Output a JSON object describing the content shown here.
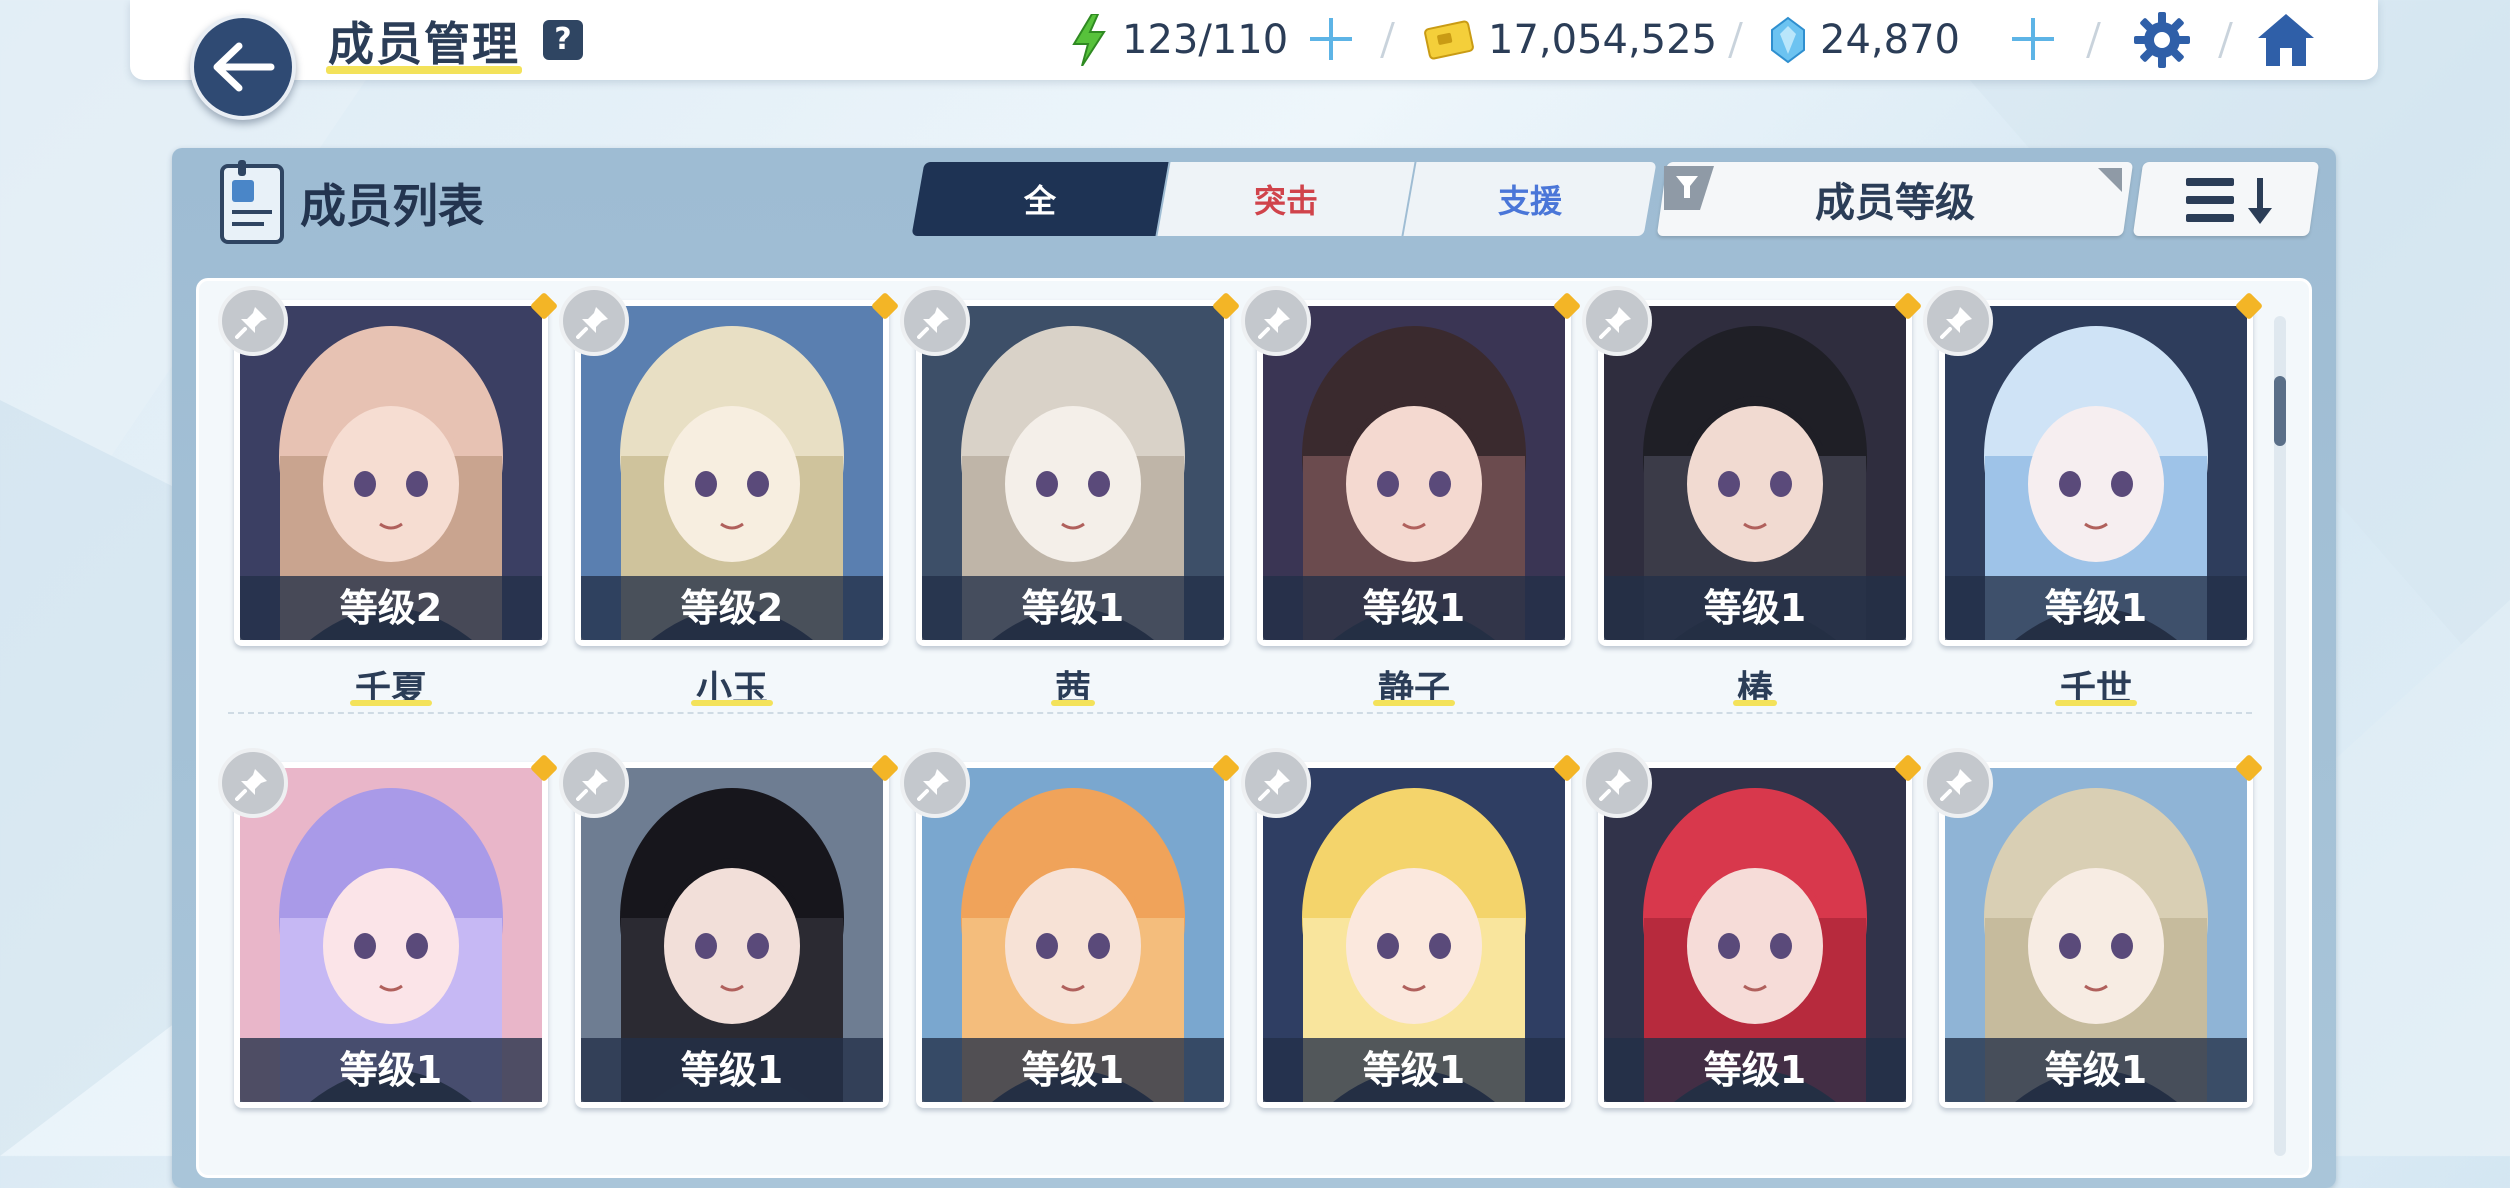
{
  "header": {
    "title": "成员管理",
    "help": "?",
    "energy": "123/110",
    "credits": "17,054,525",
    "gems": "24,870"
  },
  "panel": {
    "title": "成员列表",
    "tabs": [
      {
        "label": "全",
        "active": true
      },
      {
        "label": "突击",
        "active": false
      },
      {
        "label": "支援",
        "active": false
      }
    ],
    "filter_label": "成员等级"
  },
  "colors": {
    "accent_dark": "#1e3354",
    "striker_red": "#d0434b",
    "special_blue": "#4a76d8",
    "underline_yellow": "#f3e25a"
  },
  "members": [
    {
      "level": "等级2",
      "name": "千夏"
    },
    {
      "level": "等级2",
      "name": "小玉"
    },
    {
      "level": "等级1",
      "name": "茜"
    },
    {
      "level": "等级1",
      "name": "静子"
    },
    {
      "level": "等级1",
      "name": "椿"
    },
    {
      "level": "等级1",
      "name": "千世"
    },
    {
      "level": "等级1",
      "name": ""
    },
    {
      "level": "等级1",
      "name": ""
    },
    {
      "level": "等级1",
      "name": ""
    },
    {
      "level": "等级1",
      "name": ""
    },
    {
      "level": "等级1",
      "name": ""
    },
    {
      "level": "等级1",
      "name": ""
    }
  ]
}
